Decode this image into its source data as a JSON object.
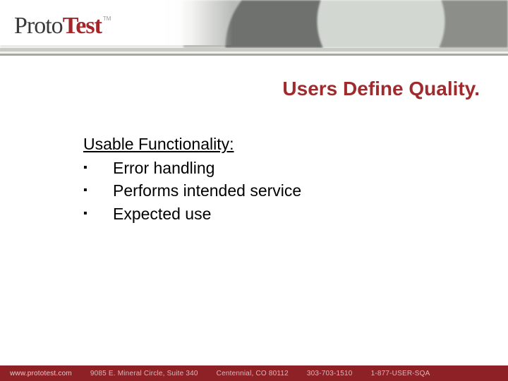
{
  "logo": {
    "left": "Proto",
    "right": "Test",
    "tm": "TM"
  },
  "title": "Users Define Quality.",
  "body": {
    "heading": "Usable Functionality:",
    "bullets": [
      "Error handling",
      "Performs intended service",
      "Expected use"
    ]
  },
  "footer": {
    "url": "www.prototest.com",
    "addr": "9085 E. Mineral Circle, Suite 340",
    "city": "Centennial, CO 80112",
    "phone": "303-703-1510",
    "tollfree": "1-877-USER-SQA"
  },
  "colors": {
    "brand_red": "#a4252a",
    "title_red": "#9f2b2e",
    "footer_bg": "#8e2126"
  }
}
